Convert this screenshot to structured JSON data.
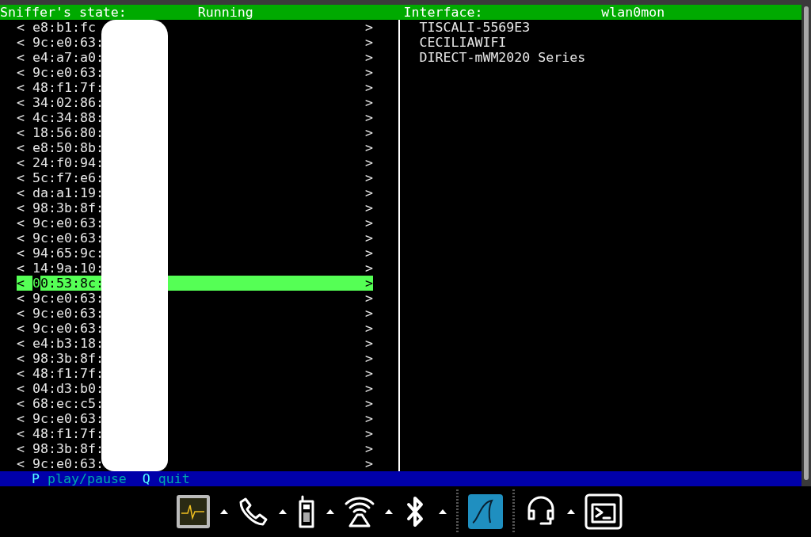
{
  "header": {
    "state_label": "Sniffer's state:",
    "state_value": "Running",
    "interface_label": "Interface:",
    "interface_value": "wlan0mon"
  },
  "devices": [
    {
      "left": "<",
      "mac": "e8:b1:fc",
      "right": ">",
      "selected": false
    },
    {
      "left": "<",
      "mac": "9c:e0:63:",
      "right": ">",
      "selected": false
    },
    {
      "left": "<",
      "mac": "e4:a7:a0:",
      "right": ">",
      "selected": false
    },
    {
      "left": "<",
      "mac": "9c:e0:63:",
      "right": ">",
      "selected": false
    },
    {
      "left": "<",
      "mac": "48:f1:7f:",
      "right": ">",
      "selected": false
    },
    {
      "left": "<",
      "mac": "34:02:86:",
      "right": ">",
      "selected": false
    },
    {
      "left": "<",
      "mac": "4c:34:88:",
      "right": ">",
      "selected": false
    },
    {
      "left": "<",
      "mac": "18:56:80:",
      "right": ">",
      "selected": false
    },
    {
      "left": "<",
      "mac": "e8:50:8b:",
      "right": ">",
      "selected": false
    },
    {
      "left": "<",
      "mac": "24:f0:94:",
      "right": ">",
      "selected": false
    },
    {
      "left": "<",
      "mac": "5c:f7:e6:",
      "right": ">",
      "selected": false
    },
    {
      "left": "<",
      "mac": "da:a1:19:",
      "right": ">",
      "selected": false
    },
    {
      "left": "<",
      "mac": "98:3b:8f:",
      "right": ">",
      "selected": false
    },
    {
      "left": "<",
      "mac": "9c:e0:63:",
      "right": ">",
      "selected": false
    },
    {
      "left": "<",
      "mac": "9c:e0:63:",
      "right": ">",
      "selected": false
    },
    {
      "left": "<",
      "mac": "94:65:9c:",
      "right": ">",
      "selected": false
    },
    {
      "left": "<",
      "mac": "14:9a:10:",
      "right": ">",
      "selected": false
    },
    {
      "left": "<",
      "mac": "00:53:8c:",
      "right": ">",
      "selected": true
    },
    {
      "left": "<",
      "mac": "9c:e0:63:",
      "right": ">",
      "selected": false
    },
    {
      "left": "<",
      "mac": "9c:e0:63:",
      "right": ">",
      "selected": false
    },
    {
      "left": "<",
      "mac": "9c:e0:63:",
      "right": ">",
      "selected": false
    },
    {
      "left": "<",
      "mac": "e4:b3:18:",
      "right": ">",
      "selected": false
    },
    {
      "left": "<",
      "mac": "98:3b:8f:",
      "right": ">",
      "selected": false
    },
    {
      "left": "<",
      "mac": "48:f1:7f:",
      "right": ">",
      "selected": false
    },
    {
      "left": "<",
      "mac": "04:d3:b0:",
      "right": ">",
      "selected": false
    },
    {
      "left": "<",
      "mac": "68:ec:c5:",
      "right": ">",
      "selected": false
    },
    {
      "left": "<",
      "mac": "9c:e0:63:",
      "right": ">",
      "selected": false
    },
    {
      "left": "<",
      "mac": "48:f1:7f:",
      "right": ">",
      "selected": false
    },
    {
      "left": "<",
      "mac": "98:3b:8f:",
      "right": ">",
      "selected": false
    },
    {
      "left": "<",
      "mac": "9c:e0:63:",
      "right": ">",
      "selected": false
    }
  ],
  "networks": [
    "TISCALI-5569E3",
    "CECILIAWIFI",
    "DIRECT-mWM2020 Series"
  ],
  "footer": [
    {
      "key": "P",
      "action": "play/pause"
    },
    {
      "key": "Q",
      "action": "quit"
    }
  ],
  "taskbar": [
    {
      "kind": "monitor"
    },
    {
      "kind": "arrow"
    },
    {
      "kind": "phone"
    },
    {
      "kind": "arrow"
    },
    {
      "kind": "mobile"
    },
    {
      "kind": "arrow"
    },
    {
      "kind": "wifi"
    },
    {
      "kind": "arrow"
    },
    {
      "kind": "bluetooth"
    },
    {
      "kind": "arrow"
    },
    {
      "kind": "separator"
    },
    {
      "kind": "fin"
    },
    {
      "kind": "separator"
    },
    {
      "kind": "headset"
    },
    {
      "kind": "arrow"
    },
    {
      "kind": "terminal"
    }
  ]
}
